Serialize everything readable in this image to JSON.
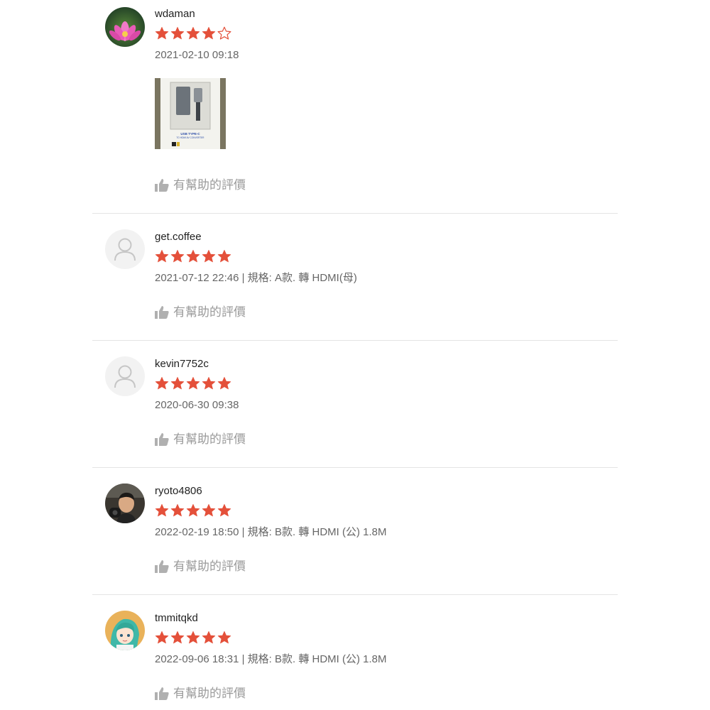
{
  "theme": {
    "star_color": "#e4503a",
    "muted_text": "#666666",
    "helpful_color": "#9a9a9a"
  },
  "reviews": [
    {
      "username": "wdaman",
      "rating": 4,
      "meta": "2021-02-10 09:18",
      "avatar": "lotus-flower-photo",
      "photo": {
        "icon": "usb-type-c-adapter-box-photo",
        "line1": "USB TYPE-C",
        "line2": "TO HDMI AV CONVERTER"
      },
      "helpful_label": "有幫助的評價"
    },
    {
      "username": "get.coffee",
      "rating": 5,
      "meta": "2021-07-12 22:46 | 規格: A款. 轉 HDMI(母)",
      "avatar": "default-user-icon",
      "helpful_label": "有幫助的評價"
    },
    {
      "username": "kevin7752c",
      "rating": 5,
      "meta": "2020-06-30 09:38",
      "avatar": "default-user-icon",
      "helpful_label": "有幫助的評價"
    },
    {
      "username": "ryoto4806",
      "rating": 5,
      "meta": "2022-02-19 18:50 | 規格: B款. 轉 HDMI (公) 1.8M",
      "avatar": "person-photo",
      "helpful_label": "有幫助的評價"
    },
    {
      "username": "tmmitqkd",
      "rating": 5,
      "meta": "2022-09-06 18:31 | 規格: B款. 轉 HDMI (公) 1.8M",
      "avatar": "anime-character-photo",
      "helpful_label": "有幫助的評價"
    }
  ]
}
